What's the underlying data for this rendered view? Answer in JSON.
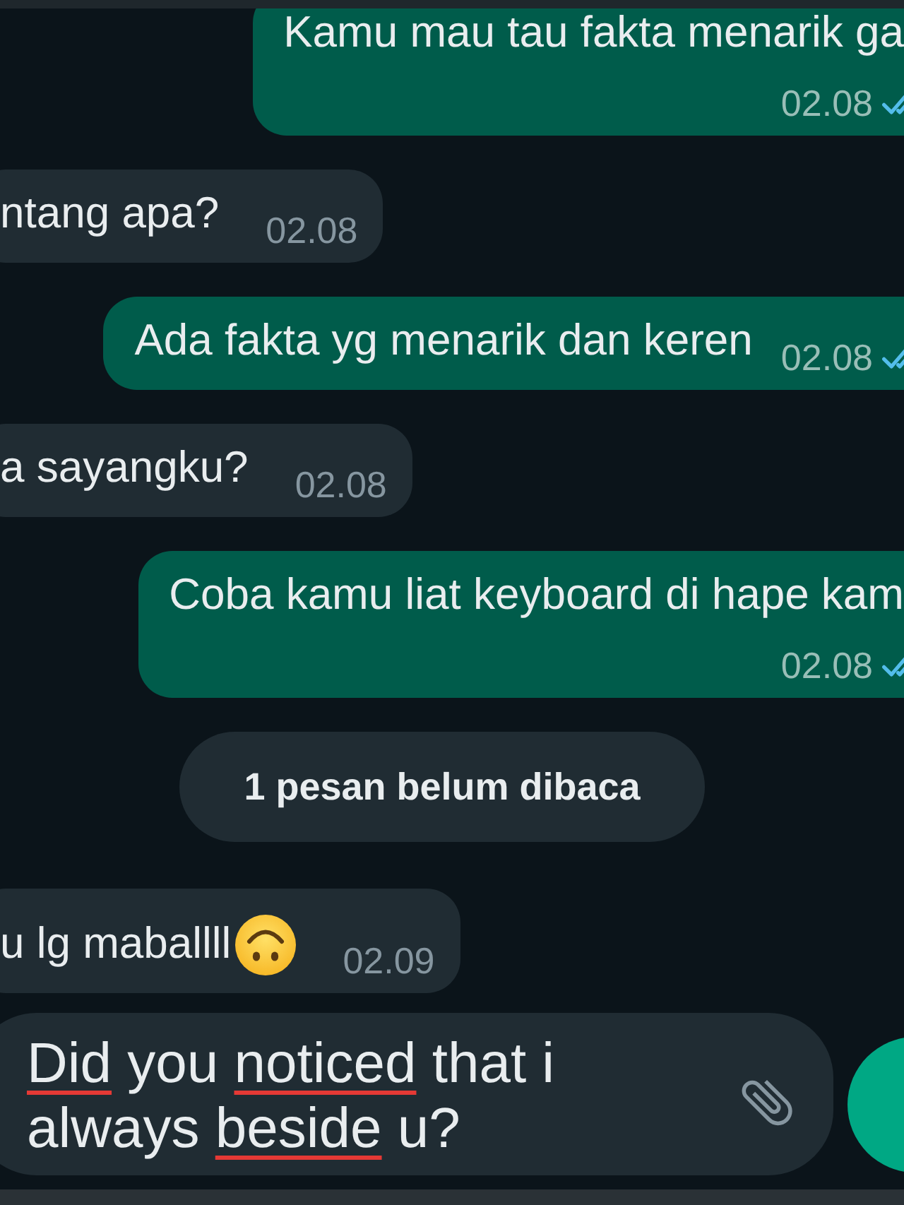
{
  "messages": [
    {
      "kind": "message",
      "outgoing": true,
      "text": "Kamu mau tau fakta menarik ga",
      "time": "02.08",
      "time_below": true,
      "read": true
    },
    {
      "kind": "message",
      "outgoing": false,
      "text": "ntang apa?",
      "time": "02.08",
      "time_below": false
    },
    {
      "kind": "message",
      "outgoing": true,
      "text": "Ada fakta yg menarik dan keren",
      "time": "02.08",
      "time_below": false,
      "read": true
    },
    {
      "kind": "message",
      "outgoing": false,
      "text": "a sayangku?",
      "time": "02.08",
      "time_below": false
    },
    {
      "kind": "message",
      "outgoing": true,
      "text": "Coba kamu liat keyboard di hape kam",
      "time": "02.08",
      "time_below": true,
      "read": true
    },
    {
      "kind": "unread_divider",
      "text": "1 pesan belum dibaca"
    },
    {
      "kind": "message",
      "outgoing": false,
      "text": "u lg maballll",
      "time": "02.09",
      "time_below": false,
      "trailing_emoji": true
    }
  ],
  "composer": {
    "value_parts": [
      {
        "text": "Did",
        "misspelled": true
      },
      {
        "text": " you ",
        "misspelled": false
      },
      {
        "text": "noticed",
        "misspelled": true
      },
      {
        "text": " that i always ",
        "misspelled": false
      },
      {
        "text": "beside",
        "misspelled": true
      },
      {
        "text": " u?",
        "misspelled": false
      }
    ]
  }
}
